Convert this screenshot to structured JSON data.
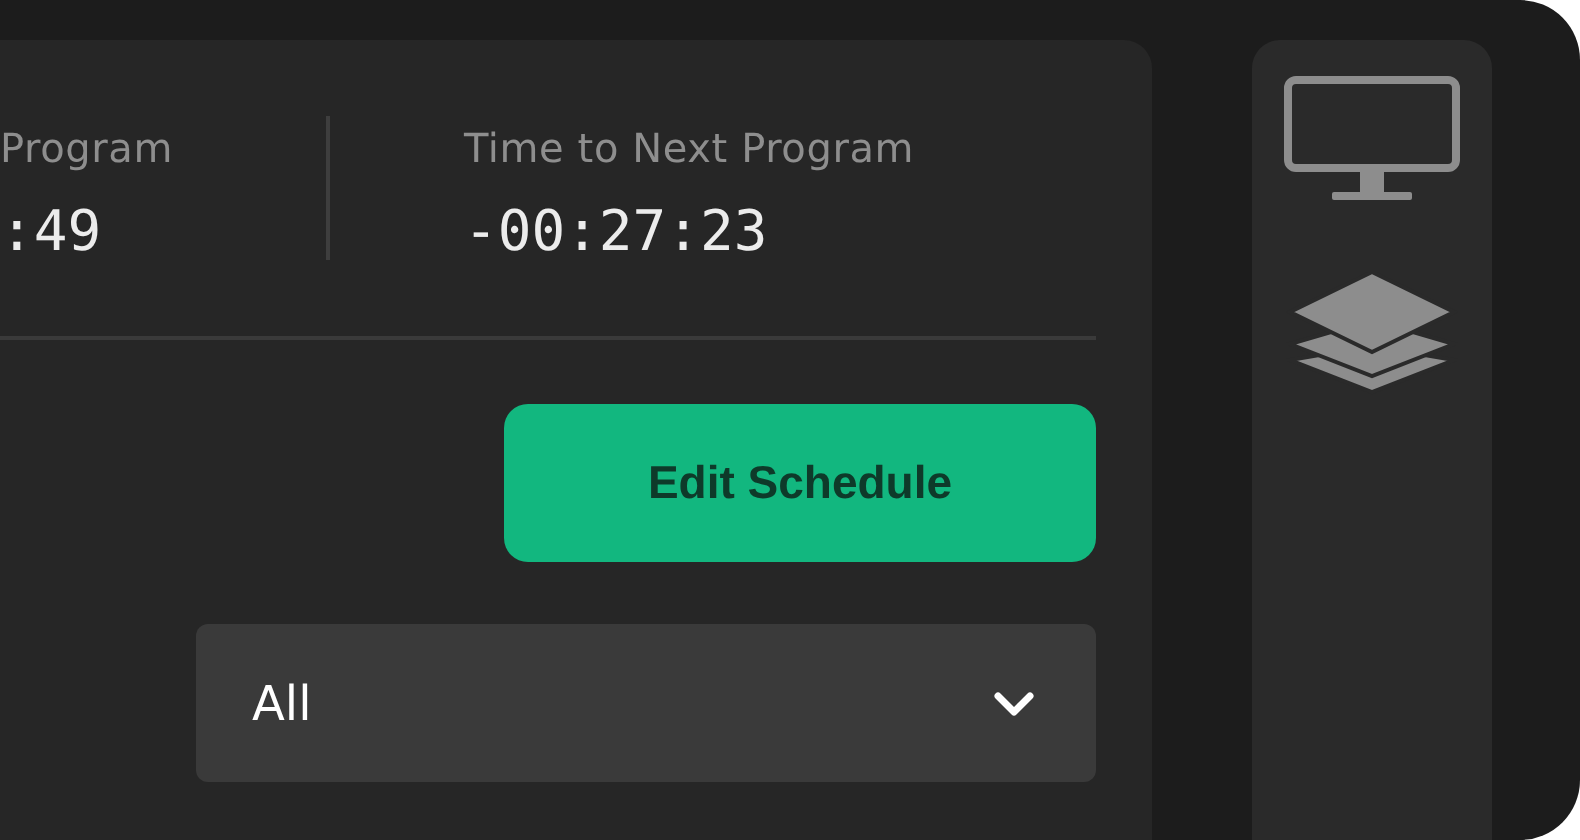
{
  "stats": [
    {
      "label": "Program",
      "value": ":49"
    },
    {
      "label": "Time to Next Program",
      "value": "-00:27:23"
    }
  ],
  "edit_button": {
    "label": "Edit Schedule"
  },
  "filter": {
    "value": "All"
  }
}
